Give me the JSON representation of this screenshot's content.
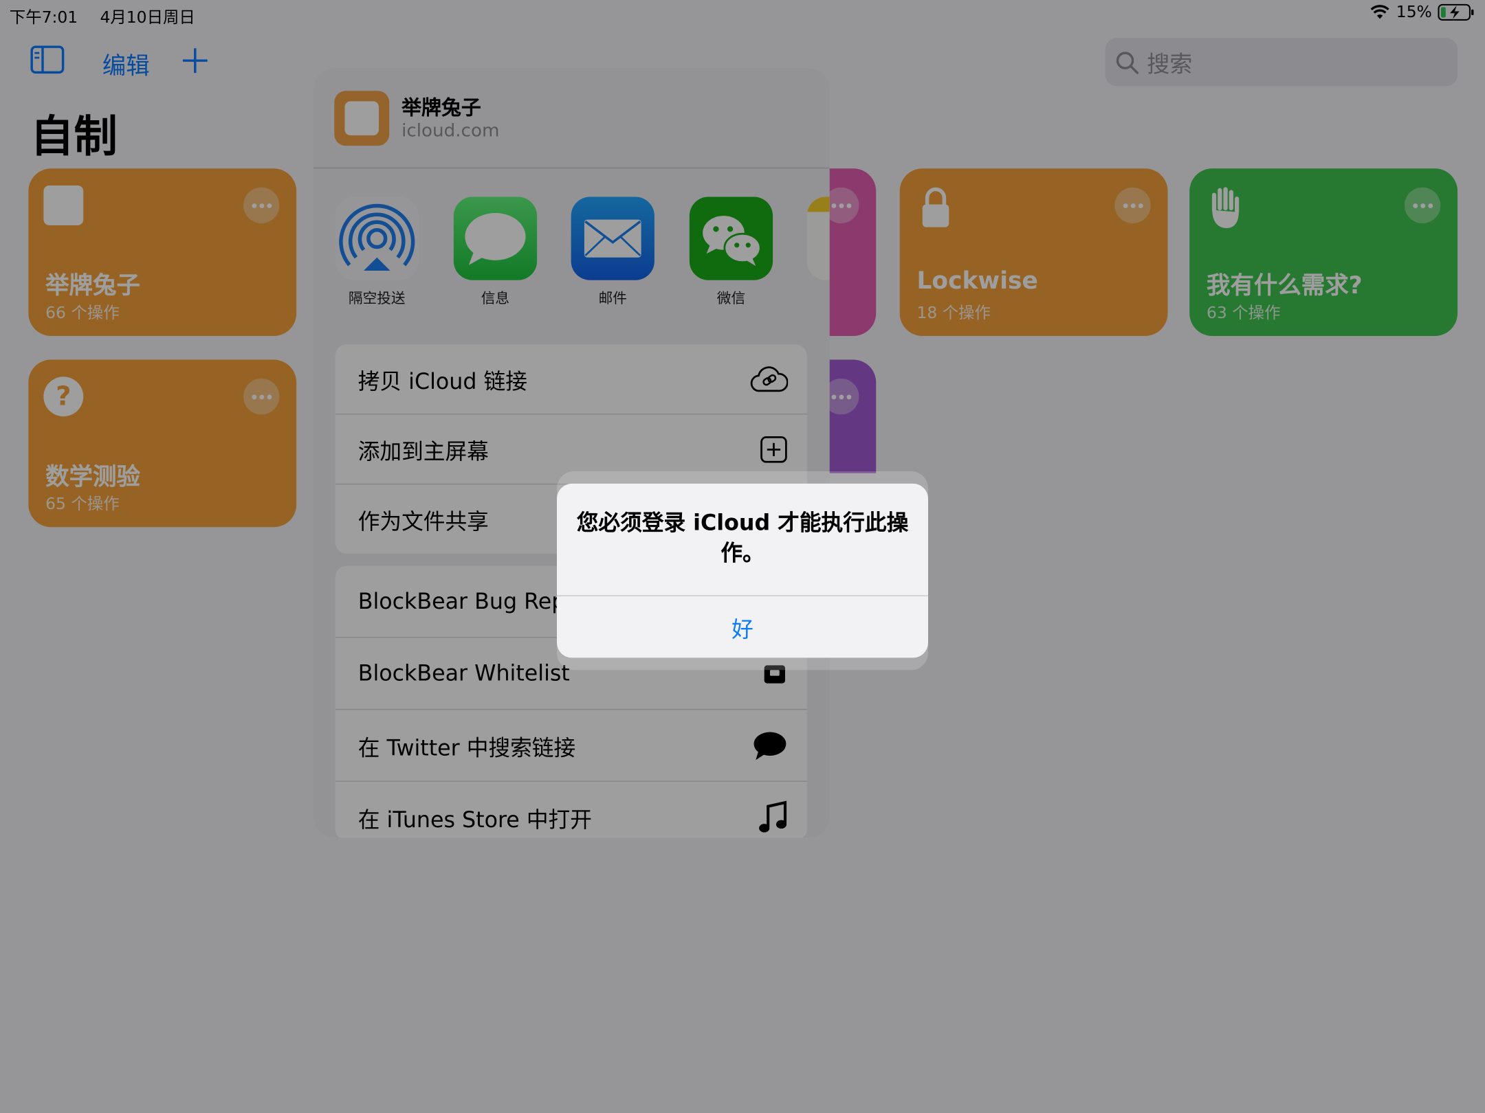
{
  "status_bar": {
    "time": "下午7:01",
    "date": "4月10日周日",
    "battery": "15%"
  },
  "toolbar": {
    "edit_label": "编辑",
    "search_placeholder": "搜索"
  },
  "page": {
    "title": "自制"
  },
  "cards": [
    {
      "title": "举牌兔子",
      "subtitle": "66 个操作",
      "color": "#f2a03c",
      "icon": "square-icon"
    },
    {
      "title": "Lockwise",
      "subtitle": "18 个操作",
      "color": "#f2a03c",
      "icon": "lock-icon"
    },
    {
      "title": "我有什么需求?",
      "subtitle": "63 个操作",
      "color": "#3fc34f",
      "icon": "hand-icon"
    },
    {
      "title": "数学测验",
      "subtitle": "65 个操作",
      "color": "#f2a03c",
      "icon": "question-icon"
    }
  ],
  "share_sheet": {
    "title": "举牌兔子",
    "subtitle": "icloud.com",
    "apps": [
      {
        "label": "隔空投送",
        "icon": "airdrop-icon"
      },
      {
        "label": "信息",
        "icon": "messages-icon"
      },
      {
        "label": "邮件",
        "icon": "mail-icon"
      },
      {
        "label": "微信",
        "icon": "wechat-icon"
      }
    ],
    "actions_group1": [
      {
        "label": "拷贝 iCloud 链接",
        "icon": "cloud-link-icon"
      },
      {
        "label": "添加到主屏幕",
        "icon": "add-square-icon"
      },
      {
        "label": "作为文件共享",
        "icon": "file-icon"
      }
    ],
    "actions_group2": [
      {
        "label": "BlockBear Bug Rep",
        "icon": "bug-icon"
      },
      {
        "label": "BlockBear Whitelist",
        "icon": "robot-icon"
      },
      {
        "label": "在 Twitter 中搜索链接",
        "icon": "speech-bubble-icon"
      },
      {
        "label": "在 iTunes Store 中打开",
        "icon": "music-note-icon"
      }
    ]
  },
  "alert": {
    "message": "您必须登录 iCloud 才能执行此操作。",
    "ok_label": "好"
  }
}
